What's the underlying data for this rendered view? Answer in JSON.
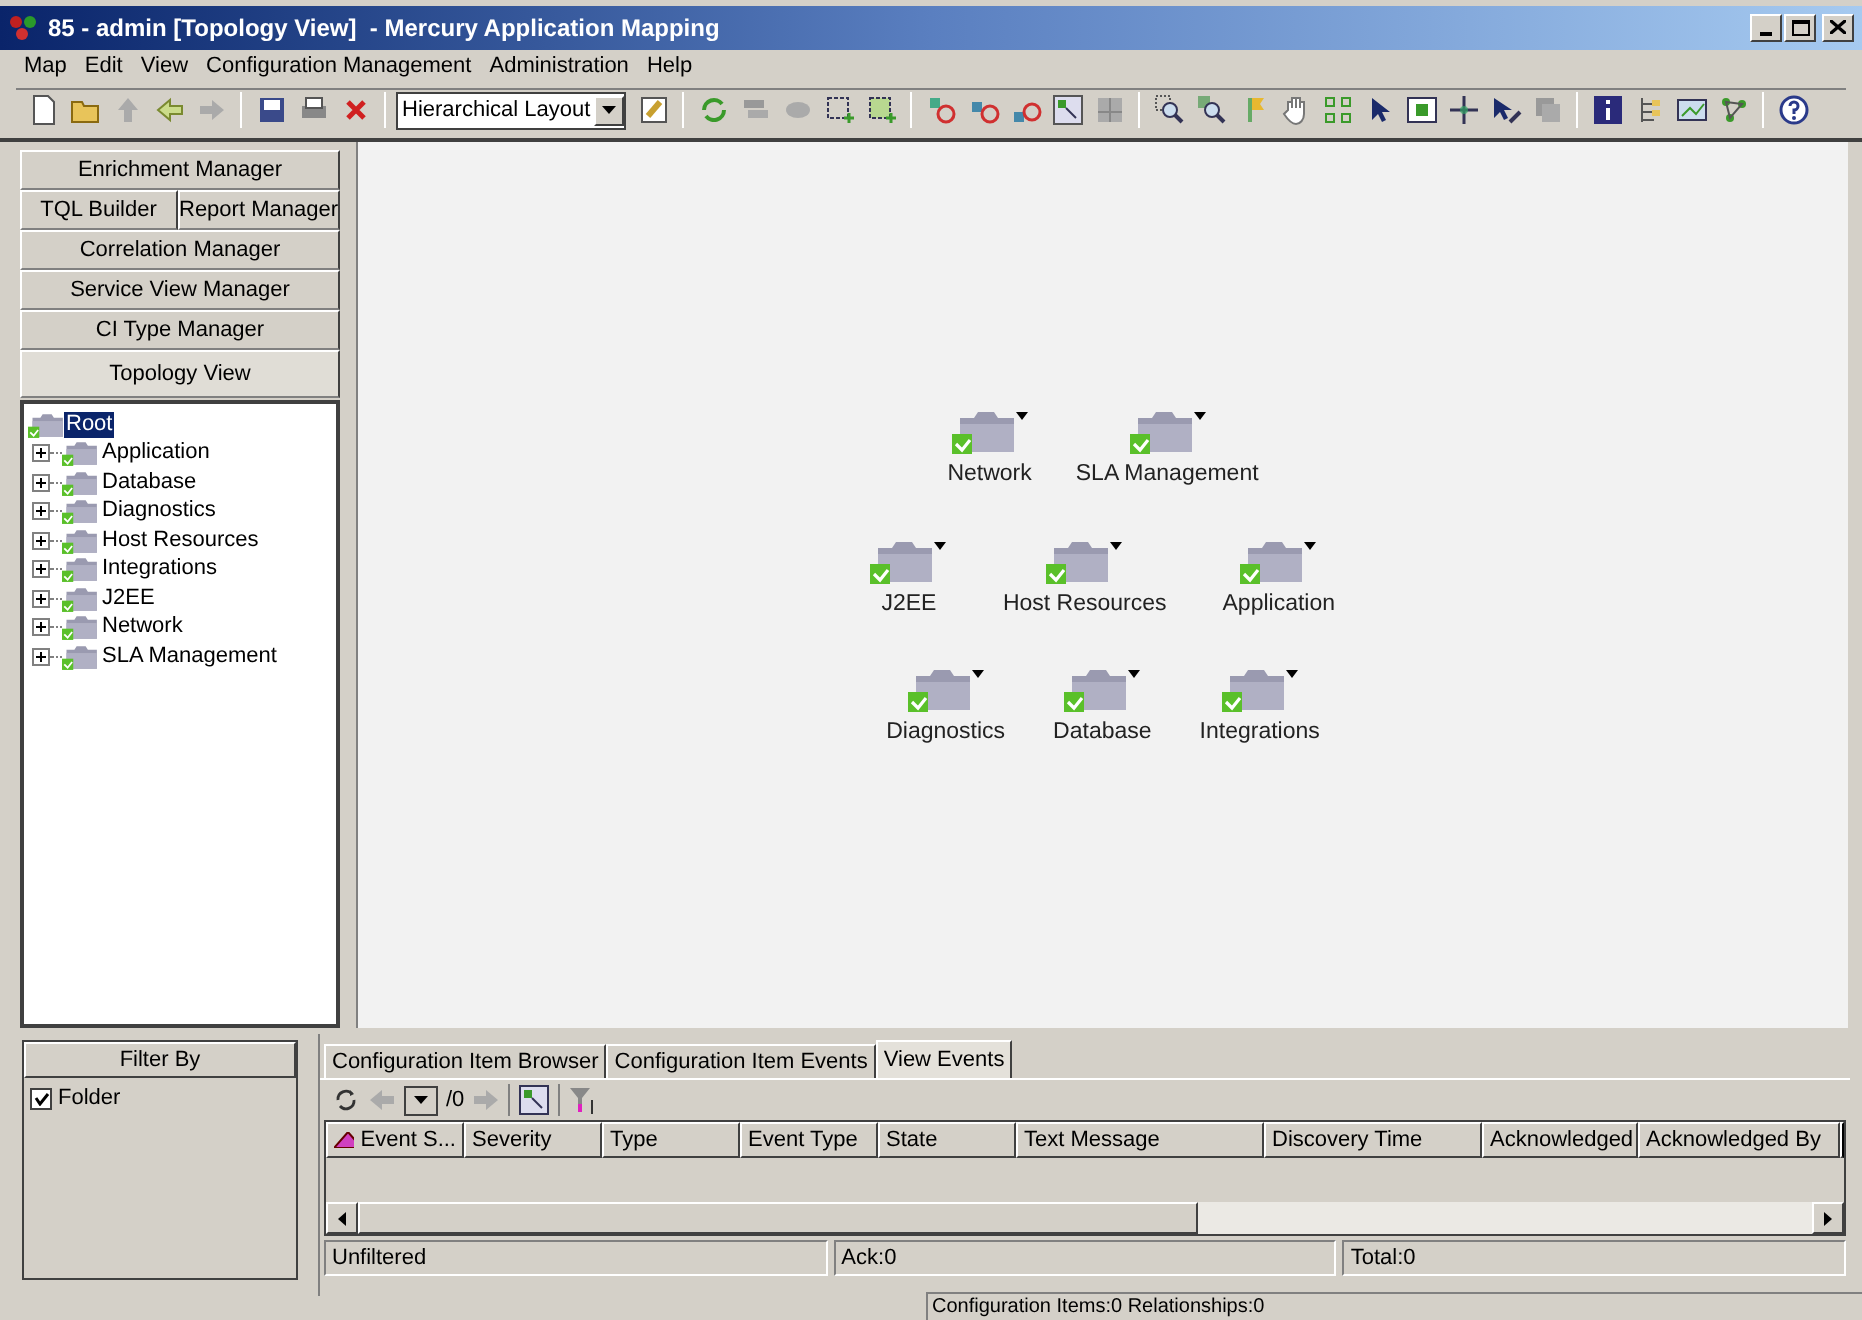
{
  "window": {
    "title": "85 - admin [Topology View]  - Mercury Application Mapping"
  },
  "menu": [
    {
      "label": "Map"
    },
    {
      "label": "Edit"
    },
    {
      "label": "View"
    },
    {
      "label": "Configuration Management"
    },
    {
      "label": "Administration"
    },
    {
      "label": "Help"
    }
  ],
  "toolbar": {
    "layout_select": "Hierarchical Layout"
  },
  "nav_buttons": [
    [
      {
        "label": "Enrichment Manager",
        "selected": false
      }
    ],
    [
      {
        "label": "TQL Builder",
        "selected": false
      },
      {
        "label": "Report Manager",
        "selected": false
      }
    ],
    [
      {
        "label": "Correlation Manager",
        "selected": false
      }
    ],
    [
      {
        "label": "Service View Manager",
        "selected": false
      }
    ],
    [
      {
        "label": "CI Type Manager",
        "selected": false
      }
    ],
    [
      {
        "label": "Topology View",
        "selected": true
      }
    ]
  ],
  "tree": {
    "label": "Root",
    "selected": true,
    "children": [
      {
        "label": "Application",
        "expanded": false,
        "selected": false
      },
      {
        "label": "Database",
        "expanded": false,
        "selected": false
      },
      {
        "label": "Diagnostics",
        "expanded": false,
        "selected": false
      },
      {
        "label": "Host Resources",
        "expanded": false,
        "selected": false
      },
      {
        "label": "Integrations",
        "expanded": false,
        "selected": false
      },
      {
        "label": "J2EE",
        "expanded": false,
        "selected": false
      },
      {
        "label": "Network",
        "expanded": false,
        "selected": false
      },
      {
        "label": "SLA Management",
        "expanded": false,
        "selected": false
      }
    ]
  },
  "canvas": {
    "rows": [
      [
        "Network",
        "SLA Management"
      ],
      [
        "J2EE",
        "Host Resources",
        "Application"
      ],
      [
        "Diagnostics",
        "Database",
        "Integrations"
      ]
    ]
  },
  "filter": {
    "title": "Filter By",
    "items": [
      {
        "label": "Folder",
        "checked": true
      }
    ]
  },
  "bottom_tabs": [
    {
      "label": "Configuration Item Browser",
      "selected": false
    },
    {
      "label": "Configuration Item Events",
      "selected": false
    },
    {
      "label": "View Events",
      "selected": true
    }
  ],
  "pager": {
    "total": "/0"
  },
  "table": {
    "columns": [
      "Event S...",
      "Severity",
      "Type",
      "Event Type",
      "State",
      "Text Message",
      "Discovery Time",
      "Acknowledged",
      "Acknowledged By"
    ]
  },
  "events_status": [
    "Unfiltered",
    "Ack:0",
    "Total:0"
  ],
  "status_bar": "Configuration Items:0 Relationships:0"
}
